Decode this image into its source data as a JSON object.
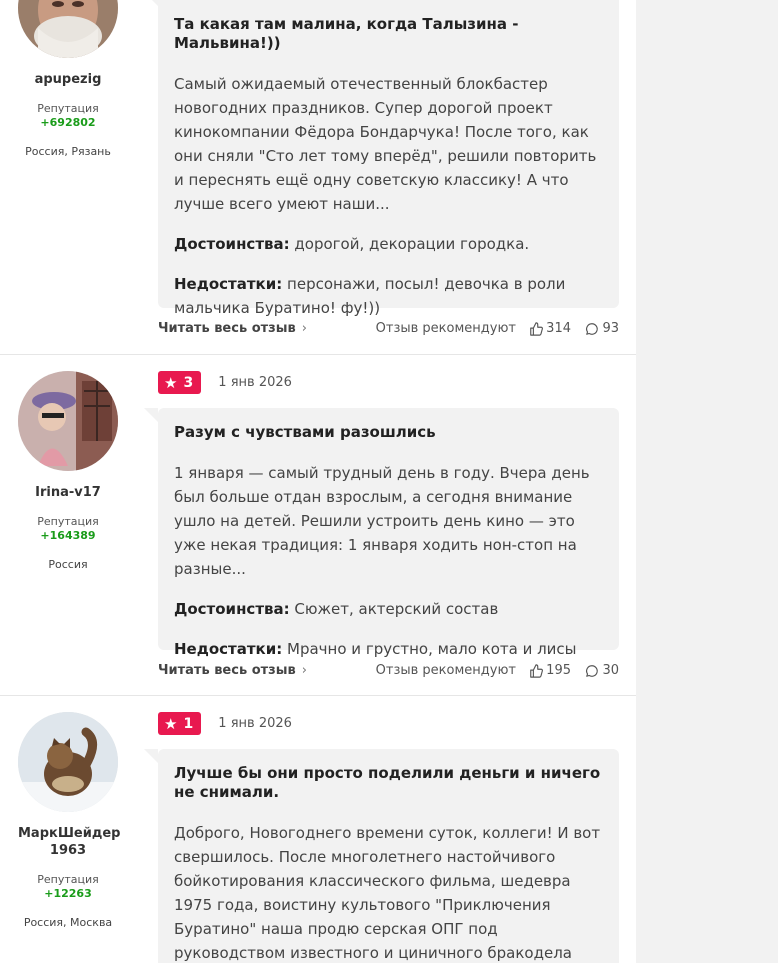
{
  "colors": {
    "rating_badge": "#e8194f",
    "reputation": "#1a9c1a",
    "card_bg": "#f2f2f2"
  },
  "common": {
    "reputation_label": "Репутация",
    "read_more": "Читать весь отзыв",
    "recommend_label": "Отзыв рекомендуют",
    "pros_label": "Достоинства:",
    "cons_label": "Недостатки:"
  },
  "reviews": [
    {
      "author": {
        "name": "apupezig",
        "reputation": "+692802",
        "location": "Россия, Рязань"
      },
      "title": "Та какая там малина, когда Талызина - Мальвина!))",
      "text": "Самый ожидаемый отечественный блокбастер новогодних праздников. Супер дорогой проект кинокомпании Фёдора Бондарчука! После того, как они сняли \"Сто лет тому вперёд\", решили повторить и переснять ещё одну советскую классику! А что лучше всего умеют наши...",
      "pros": "дорогой, декорации городка.",
      "cons": "персонажи, посыл! девочка в роли мальчика Буратино! фу!))",
      "likes": "314",
      "comments": "93"
    },
    {
      "author": {
        "name": "Irina-v17",
        "reputation": "+164389",
        "location": "Россия"
      },
      "rating": "3",
      "date": "1 янв 2026",
      "title": "Разум с чувствами разошлись",
      "text": "1 января — самый трудный день в году. Вчера день был больше отдан взрослым, а сегодня внимание ушло на детей. Решили устроить день кино — это уже некая традиция: 1 января ходить нон-стоп на разные...",
      "pros": "Сюжет, актерский состав",
      "cons": "Мрачно и грустно, мало кота и лисы",
      "likes": "195",
      "comments": "30"
    },
    {
      "author": {
        "name": "МаркШейдер 1963",
        "reputation": "+12263",
        "location": "Россия, Москва"
      },
      "rating": "1",
      "date": "1 янв 2026",
      "title": "Лучше бы они просто поделили деньги и ничего не снимали.",
      "text": "Доброго, Новогоднего времени суток, коллеги! И вот свершилось. После многолетнего настойчивого бойкотирования классического фильма, шедевра 1975 года, воистину культового \"Приключения Буратино\" наша продю серская ОПГ под руководством известного и циничного бракодела рецидивиста Костика Эрнста"
    }
  ]
}
